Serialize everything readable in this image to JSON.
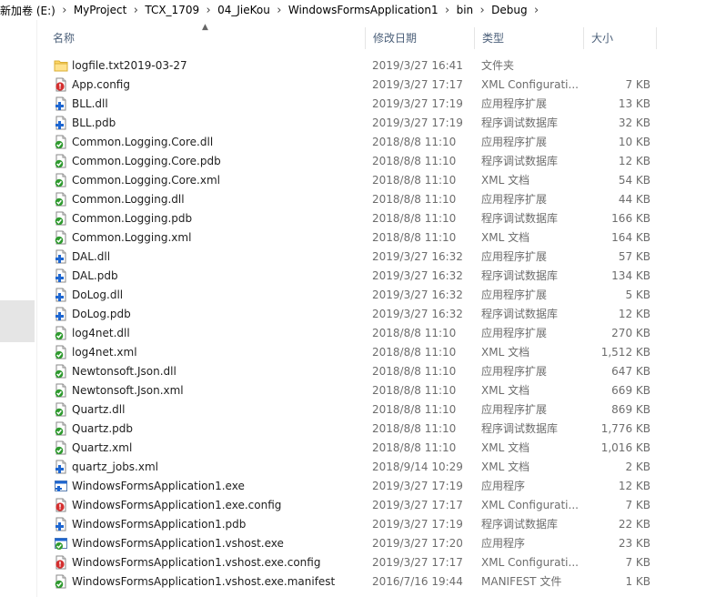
{
  "breadcrumb": [
    "新加卷 (E:)",
    "MyProject",
    "TCX_1709",
    "04_JieKou",
    "WindowsFormsApplication1",
    "bin",
    "Debug"
  ],
  "columns": {
    "name": "名称",
    "date": "修改日期",
    "type": "类型",
    "size": "大小"
  },
  "files": [
    {
      "name": "logfile.txt2019-03-27",
      "date": "2019/3/27 16:41",
      "type": "文件夹",
      "size": "",
      "icon": "folder-icon"
    },
    {
      "name": "App.config",
      "date": "2019/3/27 17:17",
      "type": "XML Configurati...",
      "size": "7 KB",
      "icon": "config-file-icon"
    },
    {
      "name": "BLL.dll",
      "date": "2019/3/27 17:19",
      "type": "应用程序扩展",
      "size": "13 KB",
      "icon": "dll-file-icon"
    },
    {
      "name": "BLL.pdb",
      "date": "2019/3/27 17:19",
      "type": "程序调试数据库",
      "size": "32 KB",
      "icon": "pdb-file-icon"
    },
    {
      "name": "Common.Logging.Core.dll",
      "date": "2018/8/8 11:10",
      "type": "应用程序扩展",
      "size": "10 KB",
      "icon": "checked-file-icon"
    },
    {
      "name": "Common.Logging.Core.pdb",
      "date": "2018/8/8 11:10",
      "type": "程序调试数据库",
      "size": "12 KB",
      "icon": "checked-file-icon"
    },
    {
      "name": "Common.Logging.Core.xml",
      "date": "2018/8/8 11:10",
      "type": "XML 文档",
      "size": "54 KB",
      "icon": "checked-file-icon"
    },
    {
      "name": "Common.Logging.dll",
      "date": "2018/8/8 11:10",
      "type": "应用程序扩展",
      "size": "44 KB",
      "icon": "checked-file-icon"
    },
    {
      "name": "Common.Logging.pdb",
      "date": "2018/8/8 11:10",
      "type": "程序调试数据库",
      "size": "166 KB",
      "icon": "checked-file-icon"
    },
    {
      "name": "Common.Logging.xml",
      "date": "2018/8/8 11:10",
      "type": "XML 文档",
      "size": "164 KB",
      "icon": "checked-file-icon"
    },
    {
      "name": "DAL.dll",
      "date": "2019/3/27 16:32",
      "type": "应用程序扩展",
      "size": "57 KB",
      "icon": "dll-file-icon"
    },
    {
      "name": "DAL.pdb",
      "date": "2019/3/27 16:32",
      "type": "程序调试数据库",
      "size": "134 KB",
      "icon": "pdb-file-icon"
    },
    {
      "name": "DoLog.dll",
      "date": "2019/3/27 16:32",
      "type": "应用程序扩展",
      "size": "5 KB",
      "icon": "dll-file-icon"
    },
    {
      "name": "DoLog.pdb",
      "date": "2019/3/27 16:32",
      "type": "程序调试数据库",
      "size": "12 KB",
      "icon": "pdb-file-icon"
    },
    {
      "name": "log4net.dll",
      "date": "2018/8/8 11:10",
      "type": "应用程序扩展",
      "size": "270 KB",
      "icon": "checked-file-icon"
    },
    {
      "name": "log4net.xml",
      "date": "2018/8/8 11:10",
      "type": "XML 文档",
      "size": "1,512 KB",
      "icon": "checked-file-icon"
    },
    {
      "name": "Newtonsoft.Json.dll",
      "date": "2018/8/8 11:10",
      "type": "应用程序扩展",
      "size": "647 KB",
      "icon": "checked-file-icon"
    },
    {
      "name": "Newtonsoft.Json.xml",
      "date": "2018/8/8 11:10",
      "type": "XML 文档",
      "size": "669 KB",
      "icon": "checked-file-icon"
    },
    {
      "name": "Quartz.dll",
      "date": "2018/8/8 11:10",
      "type": "应用程序扩展",
      "size": "869 KB",
      "icon": "checked-file-icon"
    },
    {
      "name": "Quartz.pdb",
      "date": "2018/8/8 11:10",
      "type": "程序调试数据库",
      "size": "1,776 KB",
      "icon": "checked-file-icon"
    },
    {
      "name": "Quartz.xml",
      "date": "2018/8/8 11:10",
      "type": "XML 文档",
      "size": "1,016 KB",
      "icon": "checked-file-icon"
    },
    {
      "name": "quartz_jobs.xml",
      "date": "2018/9/14 10:29",
      "type": "XML 文档",
      "size": "2 KB",
      "icon": "xml-file-icon"
    },
    {
      "name": "WindowsFormsApplication1.exe",
      "date": "2019/3/27 17:19",
      "type": "应用程序",
      "size": "12 KB",
      "icon": "exe-file-icon"
    },
    {
      "name": "WindowsFormsApplication1.exe.config",
      "date": "2019/3/27 17:17",
      "type": "XML Configurati...",
      "size": "7 KB",
      "icon": "config-file-icon"
    },
    {
      "name": "WindowsFormsApplication1.pdb",
      "date": "2019/3/27 17:19",
      "type": "程序调试数据库",
      "size": "22 KB",
      "icon": "pdb-file-icon"
    },
    {
      "name": "WindowsFormsApplication1.vshost.exe",
      "date": "2019/3/27 17:20",
      "type": "应用程序",
      "size": "23 KB",
      "icon": "checked-exe-icon"
    },
    {
      "name": "WindowsFormsApplication1.vshost.exe.config",
      "date": "2019/3/27 17:17",
      "type": "XML Configurati...",
      "size": "7 KB",
      "icon": "config-file-icon"
    },
    {
      "name": "WindowsFormsApplication1.vshost.exe.manifest",
      "date": "2016/7/16 19:44",
      "type": "MANIFEST 文件",
      "size": "1 KB",
      "icon": "checked-file-icon"
    }
  ],
  "colors": {
    "header_text": "#4c607a",
    "detail_text": "#6d6d6d",
    "folder": "#ffd868",
    "blue_badge": "#1e66d0",
    "green_check": "#2e9a2e",
    "red_badge": "#d32f2f"
  }
}
